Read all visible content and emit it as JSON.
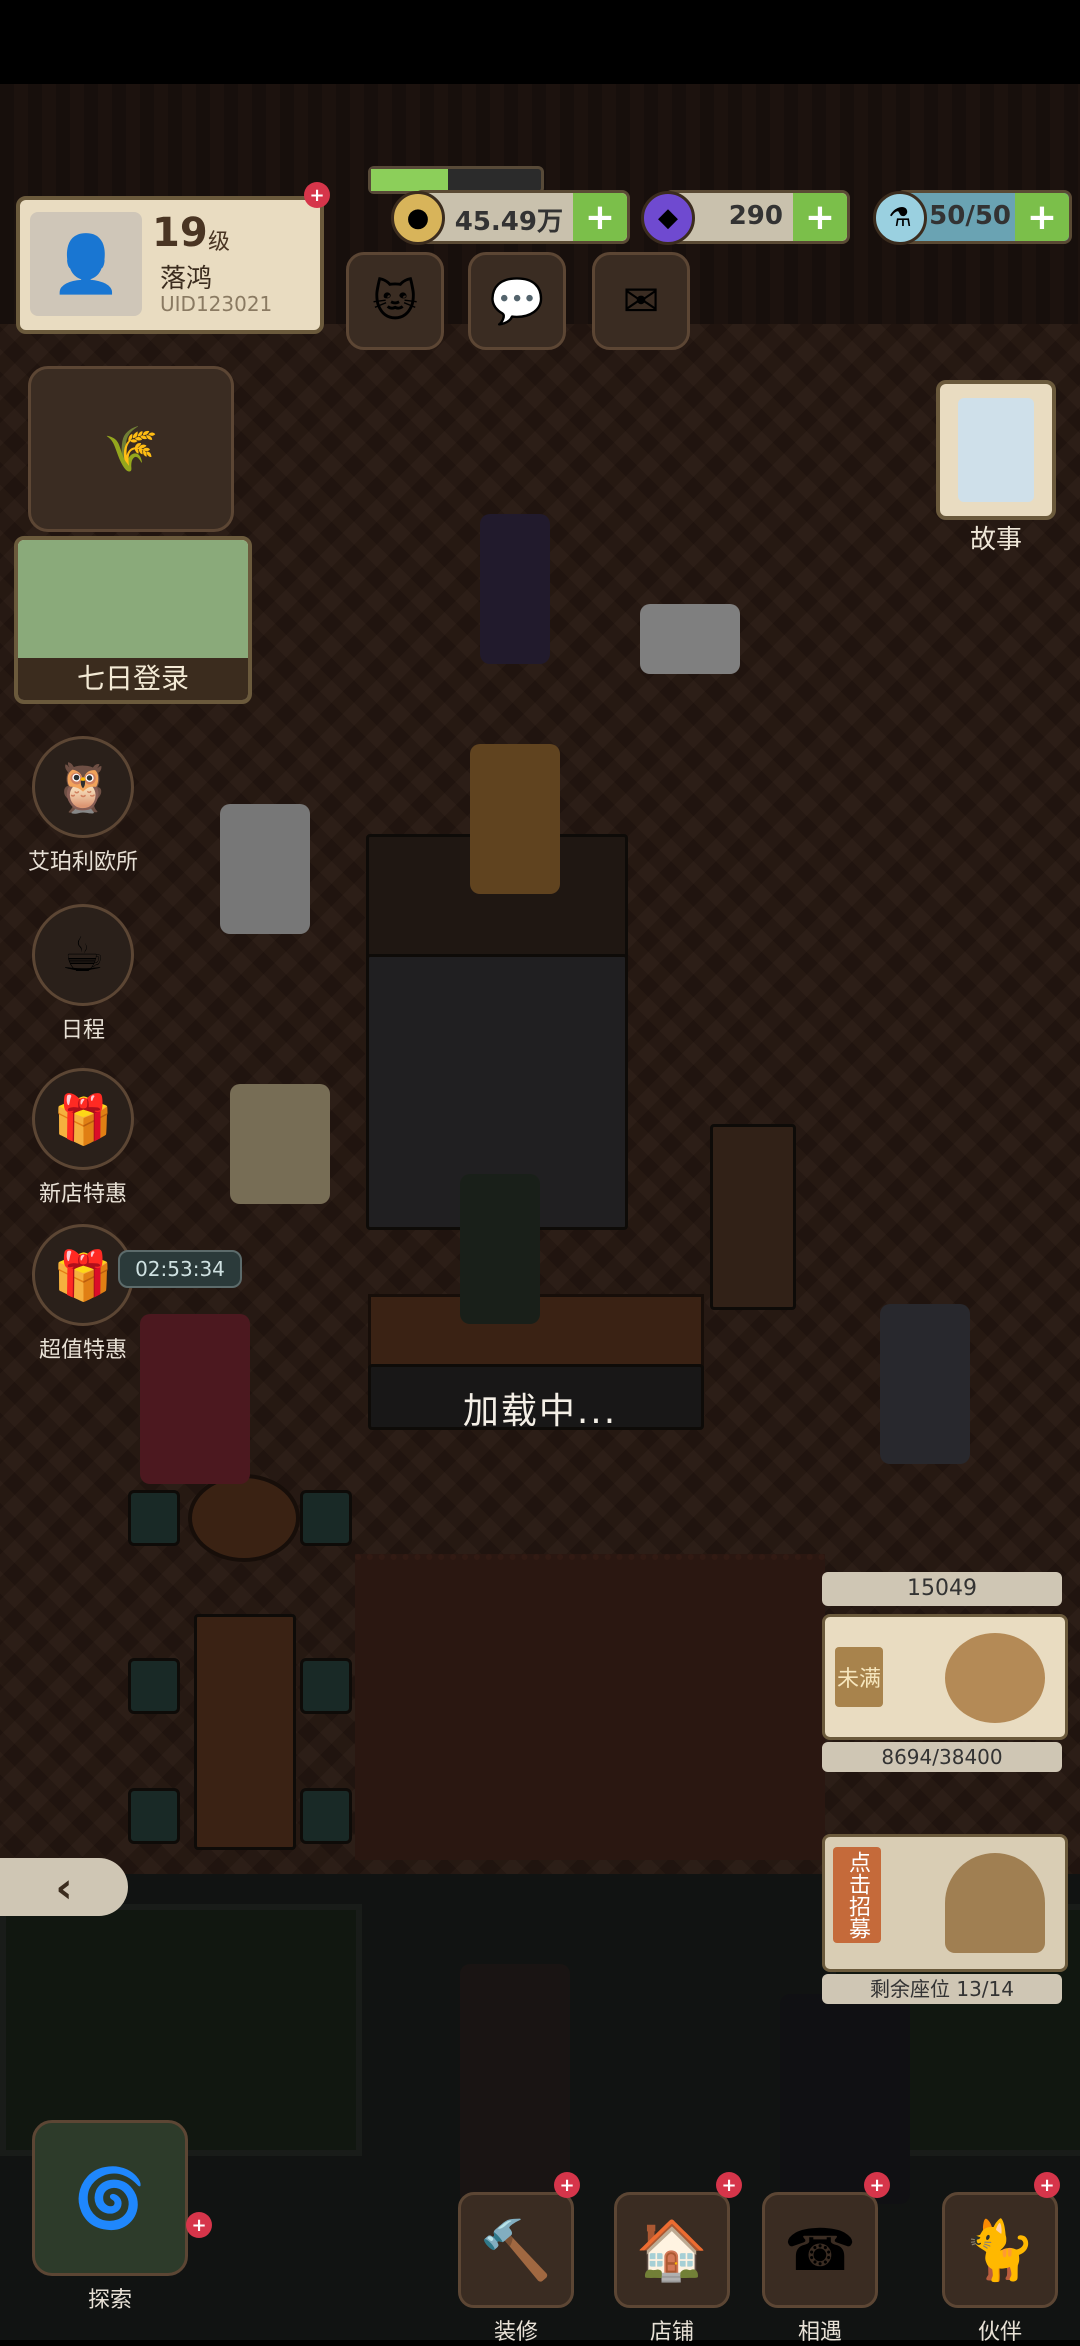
{
  "profile": {
    "level": "19",
    "level_unit": "级",
    "name": "落鸿",
    "uid": "UID123021",
    "avatar_icon": "avatar-portrait-icon"
  },
  "resources": {
    "coins": {
      "value": "45.49万",
      "icon": "coin-icon"
    },
    "gems": {
      "value": "290",
      "icon": "gem-icon"
    },
    "energy": {
      "value": "50/50",
      "icon": "potion-icon"
    }
  },
  "left_menu": [
    {
      "label": "七日登录",
      "icon": "seven-day-login-icon"
    },
    {
      "label": "艾珀利欧所",
      "icon": "owl-icon"
    },
    {
      "label": "日程",
      "icon": "schedule-icon"
    },
    {
      "label": "新店特惠",
      "icon": "gift-icon"
    },
    {
      "label": "超值特惠",
      "icon": "gift-box-icon"
    }
  ],
  "timer": "02:53:34",
  "story": {
    "label": "故事"
  },
  "loading_text": "加载中...",
  "money_box": {
    "top_value": "15049",
    "status": "未满",
    "progress_text": "8694/38400"
  },
  "recruit": {
    "label": "点击招募",
    "seats": "剩余座位 13/14"
  },
  "bottom_nav": [
    {
      "label": "探索",
      "icon": "pinwheel-icon"
    },
    {
      "label": "装修",
      "icon": "hammer-icon"
    },
    {
      "label": "店铺",
      "icon": "shop-icon"
    },
    {
      "label": "相遇",
      "icon": "meet-icon"
    },
    {
      "label": "伙伴",
      "icon": "cat-icon"
    }
  ],
  "progress_fill": 0.45
}
